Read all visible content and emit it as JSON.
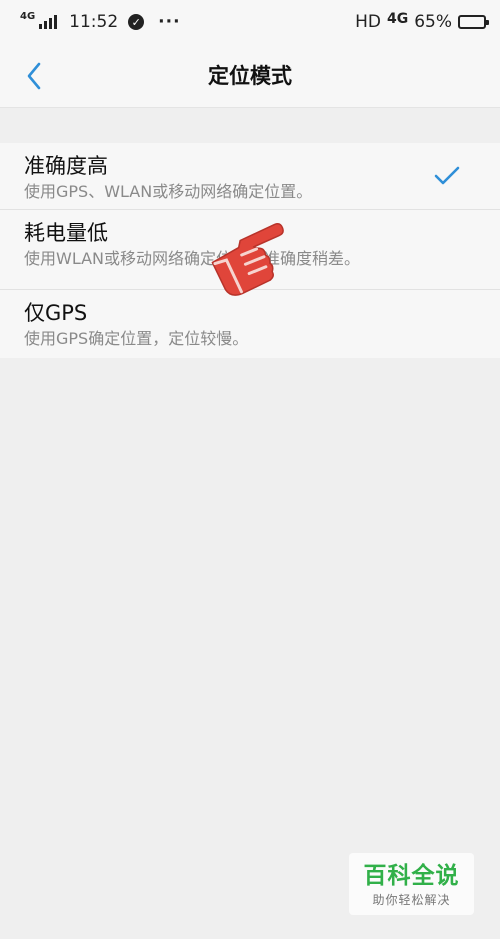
{
  "status_bar": {
    "network_small": "4G",
    "time": "11:52",
    "more": "···",
    "hd": "HD",
    "network": "4G",
    "battery_text": "65%",
    "battery_level": 0.65
  },
  "header": {
    "title": "定位模式"
  },
  "options": [
    {
      "title": "准确度高",
      "description": "使用GPS、WLAN或移动网络确定位置。",
      "selected": true
    },
    {
      "title": "耗电量低",
      "description": "使用WLAN或移动网络确定位置，准确度稍差。",
      "selected": false
    },
    {
      "title": "仅GPS",
      "description": "使用GPS确定位置，定位较慢。",
      "selected": false
    }
  ],
  "watermark": {
    "title": "百科全说",
    "subtitle": "助你轻松解决"
  },
  "colors": {
    "accent": "#2f8fd8",
    "hand": "#e0453a",
    "brand_green": "#31b049"
  },
  "icons": {
    "back": "chevron-left-icon",
    "check": "checkmark-icon",
    "hand": "pointing-hand-icon"
  }
}
